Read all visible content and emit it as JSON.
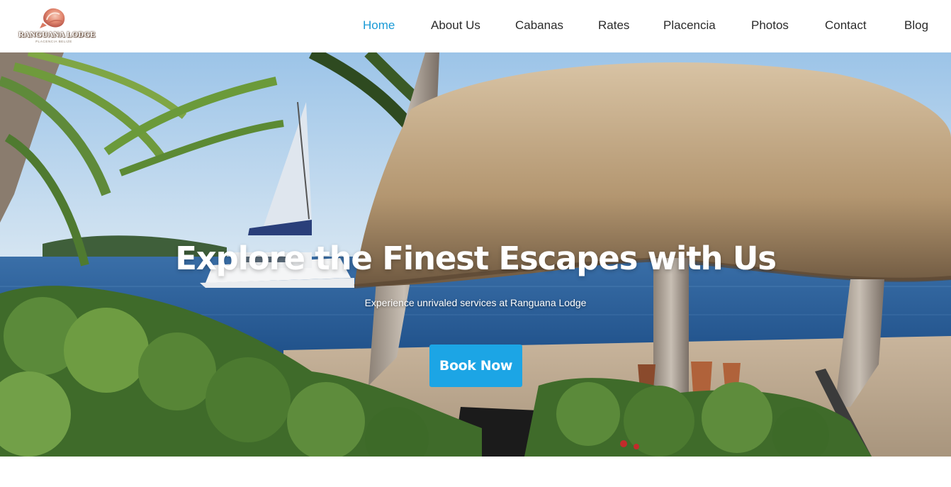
{
  "brand": {
    "name": "RANGUANA LODGE",
    "tagline": "PLACENCIA BELIZE",
    "logo_icon": "conch-shell-icon"
  },
  "nav": {
    "items": [
      {
        "label": "Home",
        "active": true
      },
      {
        "label": "About Us",
        "active": false
      },
      {
        "label": "Cabanas",
        "active": false
      },
      {
        "label": "Rates",
        "active": false
      },
      {
        "label": "Placencia",
        "active": false
      },
      {
        "label": "Photos",
        "active": false
      },
      {
        "label": "Contact",
        "active": false
      },
      {
        "label": "Blog",
        "active": false
      }
    ]
  },
  "hero": {
    "title": "Explore the Finest Escapes with Us",
    "subtitle": "Experience unrivaled services at Ranguana Lodge",
    "cta_label": "Book Now"
  },
  "colors": {
    "accent": "#1a9ad6",
    "button": "#1ca5e5",
    "text": "#2b2b2b"
  }
}
